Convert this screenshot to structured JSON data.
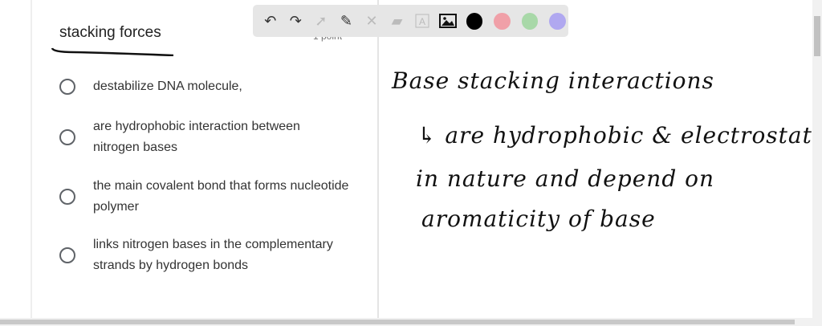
{
  "question": {
    "title": "stacking forces",
    "points": "1 point",
    "options": [
      "destabilize DNA molecule,",
      "are hydrophobic interaction between nitrogen bases",
      "the main covalent bond that forms nucleotide polymer",
      "links nitrogen bases in the complementary strands by hydrogen bonds"
    ]
  },
  "toolbar": {
    "tools": [
      "undo-icon",
      "redo-icon",
      "select-icon",
      "pen-icon",
      "tools-icon",
      "eraser-icon",
      "text-icon",
      "image-icon"
    ],
    "colors": [
      "#000000",
      "#f0a0a8",
      "#a8d8a8",
      "#b0a8f0"
    ]
  },
  "whiteboard": {
    "lines": [
      "Base stacking interactions",
      "↳ are hydrophobic & electrostatic",
      "in nature and depend on",
      "aromaticity of base"
    ]
  }
}
